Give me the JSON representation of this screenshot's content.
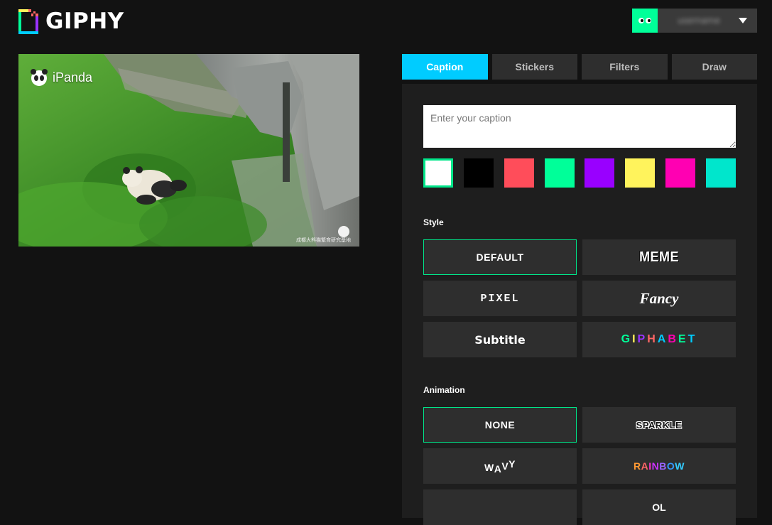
{
  "header": {
    "logo_text": "GIPHY",
    "user": {
      "name": "username",
      "avatar_color": "#00ff99"
    }
  },
  "preview": {
    "watermark": "iPanda",
    "corner_text": "成都大熊猫繁育研究基地"
  },
  "tabs": [
    {
      "label": "Caption",
      "active": true
    },
    {
      "label": "Stickers",
      "active": false
    },
    {
      "label": "Filters",
      "active": false
    },
    {
      "label": "Draw",
      "active": false
    }
  ],
  "caption": {
    "value": "",
    "placeholder": "Enter your caption",
    "colors": [
      "#ffffff",
      "#000000",
      "#ff4d5a",
      "#00ff99",
      "#9900ff",
      "#fff35c",
      "#ff00b2",
      "#00e6cc"
    ],
    "selected_color": "#ffffff"
  },
  "style": {
    "label": "Style",
    "options": [
      "DEFAULT",
      "MEME",
      "PIXEL",
      "Fancy",
      "Subtitle",
      "GIPHABET"
    ],
    "selected": "DEFAULT"
  },
  "animation": {
    "label": "Animation",
    "options": [
      "NONE",
      "SPARKLE",
      "WAVY",
      "RAINBOW",
      "",
      "OL"
    ],
    "selected": "NONE"
  },
  "colors": {
    "accent": "#00ccff",
    "selected_border": "#00e68a",
    "panel": "#1e1e1e",
    "button": "#2e2e2e",
    "background": "#121212"
  }
}
